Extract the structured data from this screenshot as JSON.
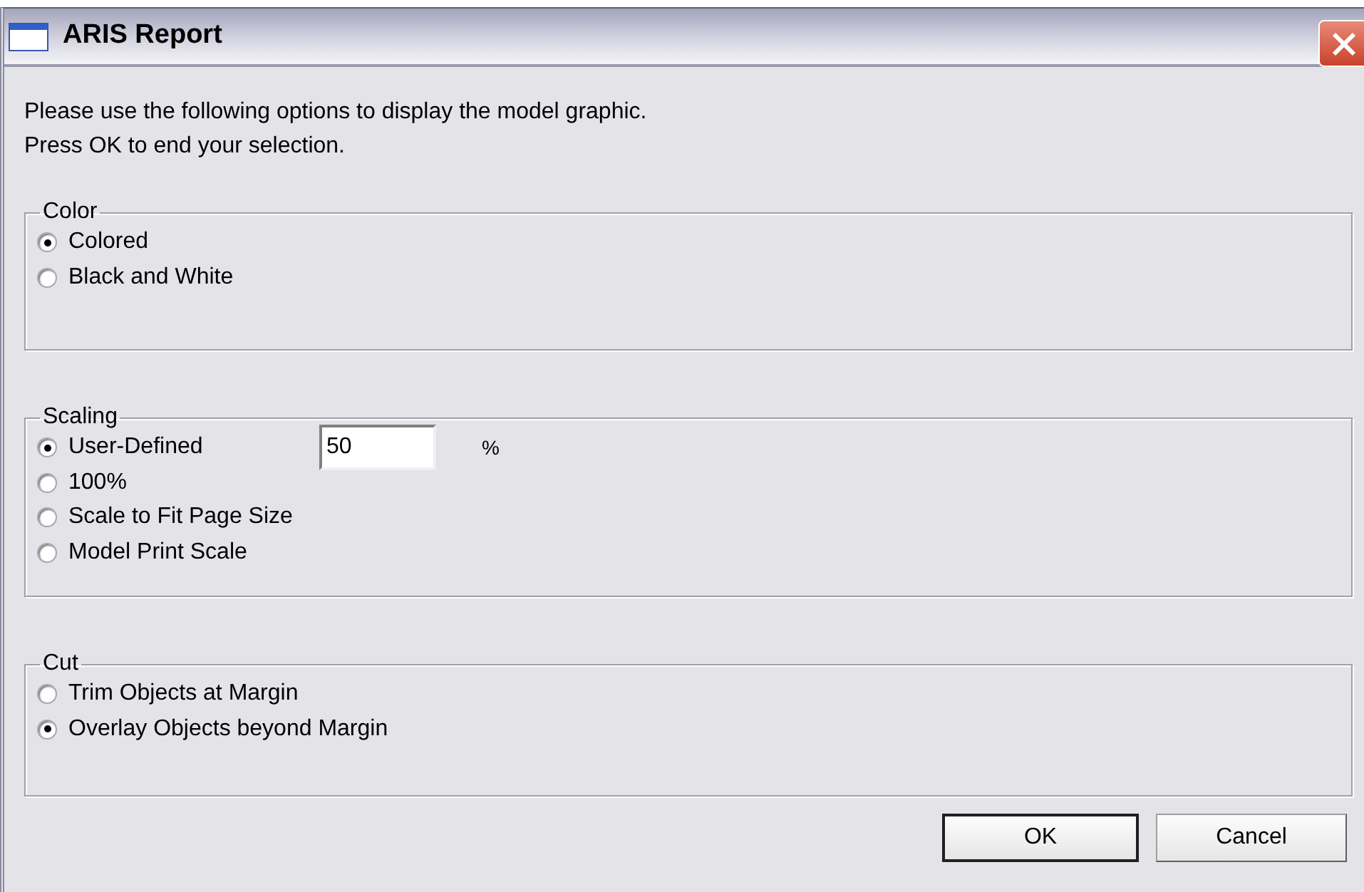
{
  "window": {
    "title": "ARIS Report"
  },
  "instructions": [
    "Please use the following options to display the model graphic.",
    "Press OK to end your selection."
  ],
  "groups": [
    {
      "title": "Color",
      "options": [
        {
          "label": "Colored",
          "selected": true,
          "kind": "plain"
        },
        {
          "label": "Black and White",
          "selected": false,
          "kind": "plain"
        }
      ]
    },
    {
      "title": "Scaling",
      "options": [
        {
          "label": "User-Defined",
          "selected": true,
          "kind": "input",
          "value": "50",
          "unit": "%"
        },
        {
          "label": "100%",
          "selected": false,
          "kind": "plain"
        },
        {
          "label": "Scale to Fit Page Size",
          "selected": false,
          "kind": "plain"
        },
        {
          "label": "Model Print Scale",
          "selected": false,
          "kind": "plain"
        }
      ]
    },
    {
      "title": "Cut",
      "options": [
        {
          "label": "Trim Objects at Margin",
          "selected": false,
          "kind": "plain"
        },
        {
          "label": "Overlay Objects beyond Margin",
          "selected": true,
          "kind": "plain"
        }
      ]
    }
  ],
  "buttons": [
    {
      "label": "OK",
      "default": true
    },
    {
      "label": "Cancel",
      "default": false
    }
  ]
}
